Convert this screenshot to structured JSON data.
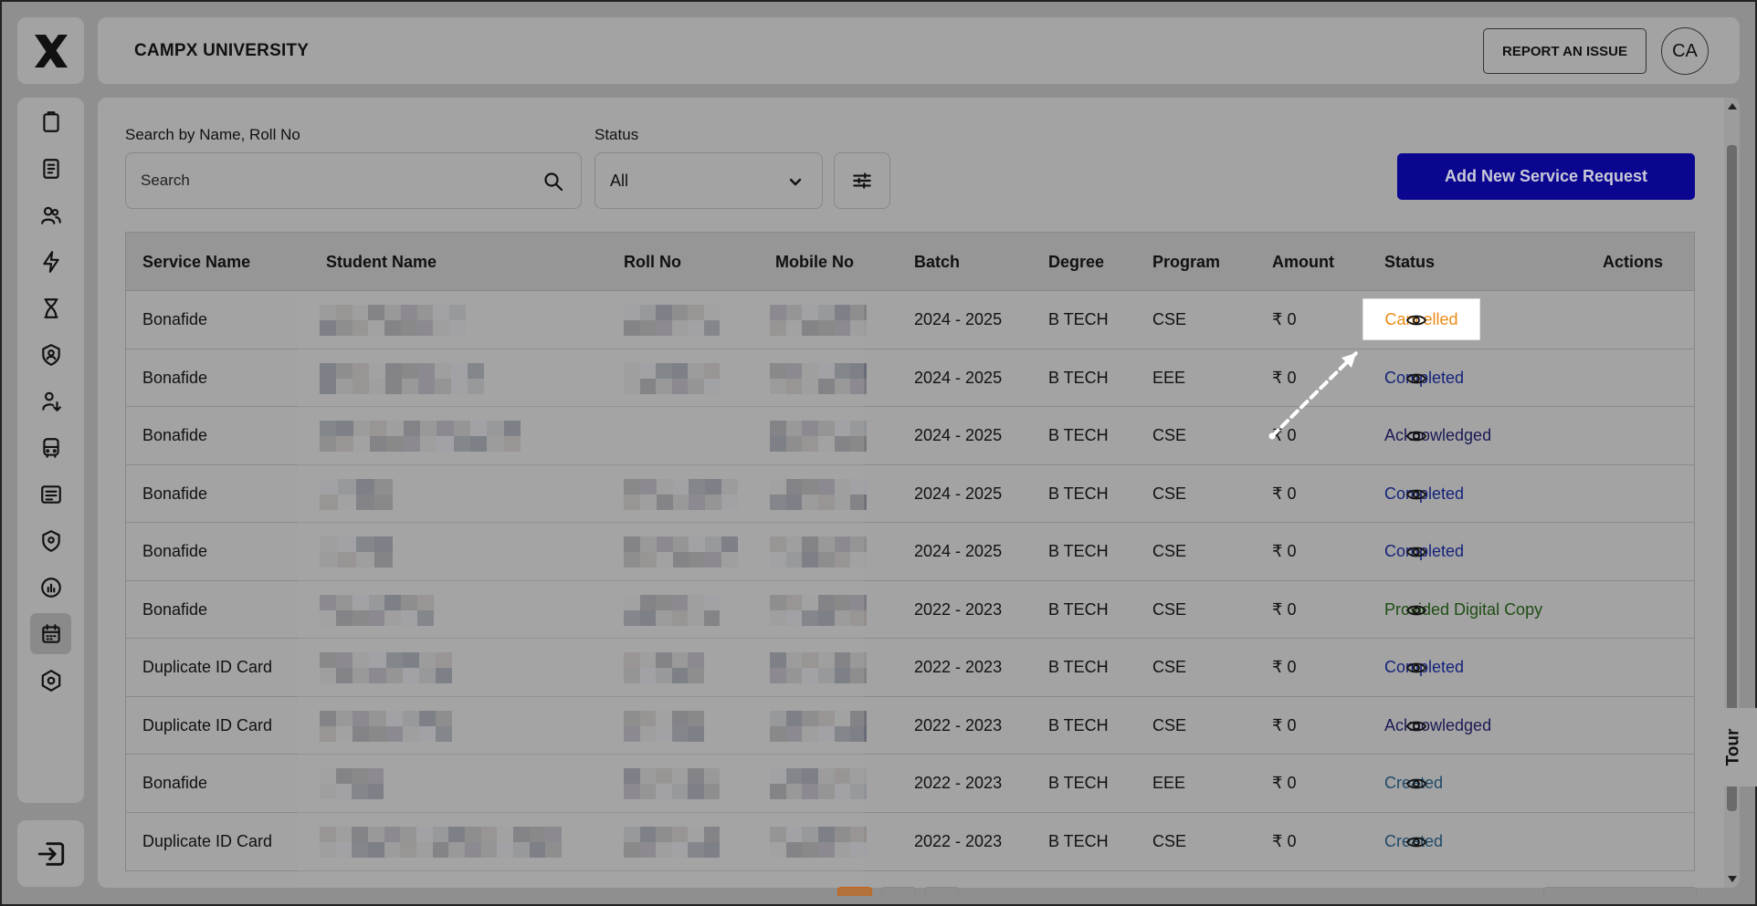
{
  "header": {
    "org_name": "CAMPX UNIVERSITY",
    "report_button": "REPORT AN ISSUE",
    "avatar_initials": "CA"
  },
  "filters": {
    "search_label": "Search by Name, Roll No",
    "search_placeholder": "Search",
    "status_label": "Status",
    "status_value": "All"
  },
  "add_button": "Add New Service Request",
  "table": {
    "columns": [
      "Service Name",
      "Student Name",
      "Roll No",
      "Mobile No",
      "Batch",
      "Degree",
      "Program",
      "Amount",
      "Status",
      "Actions"
    ],
    "rows": [
      {
        "service": "Bonafide",
        "batch": "2024 - 2025",
        "degree": "B TECH",
        "program": "CSE",
        "amount": "₹ 0",
        "status": "Cancelled"
      },
      {
        "service": "Bonafide",
        "batch": "2024 - 2025",
        "degree": "B TECH",
        "program": "EEE",
        "amount": "₹ 0",
        "status": "Completed"
      },
      {
        "service": "Bonafide",
        "batch": "2024 - 2025",
        "degree": "B TECH",
        "program": "CSE",
        "amount": "₹ 0",
        "status": "Acknowledged"
      },
      {
        "service": "Bonafide",
        "batch": "2024 - 2025",
        "degree": "B TECH",
        "program": "CSE",
        "amount": "₹ 0",
        "status": "Completed"
      },
      {
        "service": "Bonafide",
        "batch": "2024 - 2025",
        "degree": "B TECH",
        "program": "CSE",
        "amount": "₹ 0",
        "status": "Completed"
      },
      {
        "service": "Bonafide",
        "batch": "2022 - 2023",
        "degree": "B TECH",
        "program": "CSE",
        "amount": "₹ 0",
        "status": "Provided Digital Copy"
      },
      {
        "service": "Duplicate ID Card",
        "batch": "2022 - 2023",
        "degree": "B TECH",
        "program": "CSE",
        "amount": "₹ 0",
        "status": "Completed"
      },
      {
        "service": "Duplicate ID Card",
        "batch": "2022 - 2023",
        "degree": "B TECH",
        "program": "CSE",
        "amount": "₹ 0",
        "status": "Acknowledged"
      },
      {
        "service": "Bonafide",
        "batch": "2022 - 2023",
        "degree": "B TECH",
        "program": "EEE",
        "amount": "₹ 0",
        "status": "Created"
      },
      {
        "service": "Duplicate ID Card",
        "batch": "2022 - 2023",
        "degree": "B TECH",
        "program": "CSE",
        "amount": "₹ 0",
        "status": "Created"
      }
    ]
  },
  "tour_label": "Tour",
  "sidebar_icons": [
    "clipboard-icon",
    "book-icon",
    "users-icon",
    "bolt-icon",
    "hourglass-icon",
    "shield-user-icon",
    "user-cycle-icon",
    "bus-icon",
    "ledger-icon",
    "shield-pin-icon",
    "report-chart-icon",
    "calendar-icon",
    "settings-hex-icon"
  ],
  "colors": {
    "primary": "#0a0690",
    "cancelled": "#e98a14",
    "completed": "#14227a",
    "digital_copy": "#1d4d14"
  }
}
